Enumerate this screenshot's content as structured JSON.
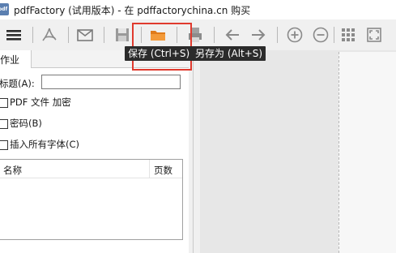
{
  "window": {
    "title": "pdfFactory (试用版本) - 在 pdffactorychina.cn 购买",
    "app_icon": "pdf"
  },
  "toolbar": {
    "icons": [
      "menu-icon",
      "pdf-acrobat-icon",
      "email-icon",
      "save-disk-icon",
      "open-folder-icon",
      "print-icon",
      "arrow-left-icon",
      "arrow-right-icon",
      "zoom-in-icon",
      "zoom-out-icon",
      "grid-view-icon",
      "fit-page-icon"
    ]
  },
  "tooltips": {
    "save": "保存 (Ctrl+S)",
    "save_as": "另存为 (Alt+S)"
  },
  "highlight_color": "#e03a2e",
  "left_panel": {
    "tab_label": "作业",
    "title_label": "标题(A):",
    "title_value": "",
    "options": [
      {
        "label": "PDF 文件 加密",
        "checked": false
      },
      {
        "label": "密码(B)",
        "checked": false
      },
      {
        "label": "插入所有字体(C)",
        "checked": false
      }
    ],
    "list": {
      "columns": [
        "名称",
        "页数"
      ],
      "rows": []
    }
  }
}
